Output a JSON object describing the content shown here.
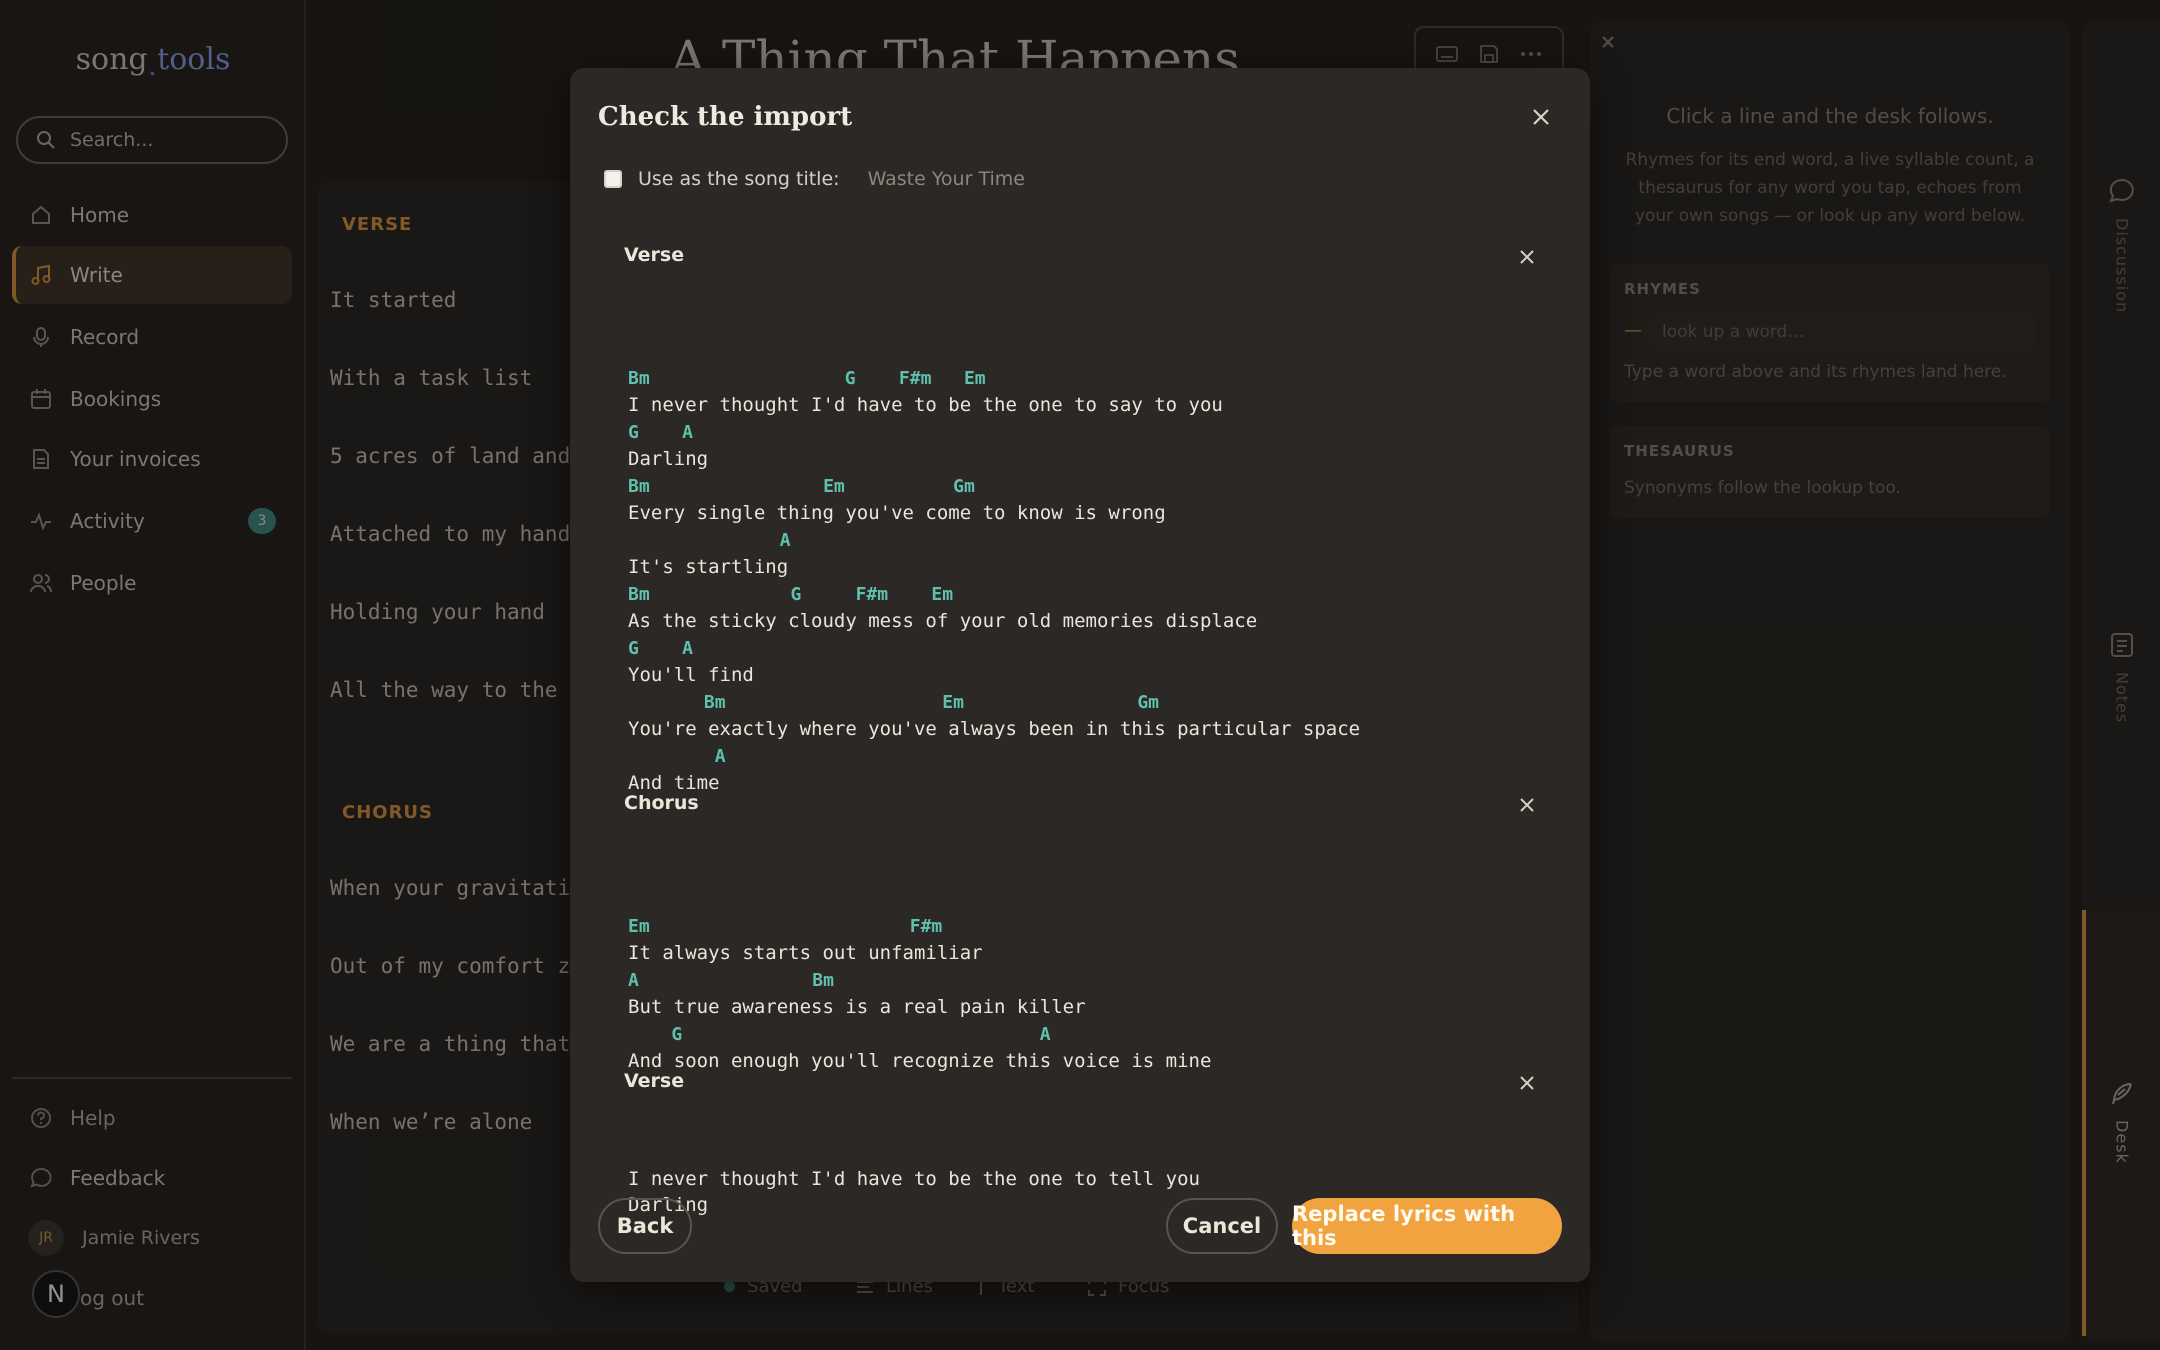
{
  "app": {
    "logo_song": "song",
    "logo_tools": "tools",
    "search_placeholder": "Search..."
  },
  "nav": [
    {
      "label": "Home",
      "icon": "home-icon"
    },
    {
      "label": "Write",
      "icon": "music-note-icon",
      "active": true
    },
    {
      "label": "Record",
      "icon": "microphone-icon"
    },
    {
      "label": "Bookings",
      "icon": "calendar-icon"
    },
    {
      "label": "Your invoices",
      "icon": "document-icon"
    },
    {
      "label": "Activity",
      "icon": "activity-icon",
      "badge": "3"
    },
    {
      "label": "People",
      "icon": "people-icon"
    }
  ],
  "footer": {
    "help": "Help",
    "feedback": "Feedback",
    "user_initials": "JR",
    "user_name": "Jamie Rivers",
    "logout": "og out",
    "n_badge": "N"
  },
  "editor": {
    "title": "A Thing That Happens",
    "verse_label": "VERSE",
    "verse_lines": [
      "It started",
      "With a task list",
      "5 acres of land and",
      "Attached to my hand",
      "Holding your hand",
      "All the way to the"
    ],
    "chorus_label": "CHORUS",
    "chorus_lines": [
      "When your gravitati",
      "Out of my comfort z",
      "We are a thing that",
      "When we’re alone"
    ],
    "status": {
      "saved": "Saved",
      "lines": "Lines",
      "text": "Text",
      "focus": "Focus"
    }
  },
  "desk": {
    "lead": "Click a line and the desk follows.",
    "sub": "Rhymes for its end word, a live syllable count, a thesaurus for any word you tap, echoes from your own songs — or look up any word below.",
    "rhymes_title": "RHYMES",
    "rhymes_placeholder": "look up a word…",
    "rhymes_hint": "Type a word above and its rhymes land here.",
    "thesaurus_title": "THESAURUS",
    "thesaurus_hint": "Synonyms follow the lookup too.",
    "rail": {
      "discussion": "Discussion",
      "notes": "Notes",
      "desk": "Desk"
    }
  },
  "modal": {
    "title": "Check the import",
    "use_title_label": "Use as the song title:",
    "song_title_value": "Waste Your Time",
    "sections": [
      {
        "name": "Verse",
        "lines": [
          {
            "chords": "Bm                  G    F#m   Em",
            "lyric": "I never thought I'd have to be the one to say to you"
          },
          {
            "chords": "G    A",
            "lyric": "Darling"
          },
          {
            "chords": "Bm                Em          Gm",
            "lyric": "Every single thing you've come to know is wrong"
          },
          {
            "chords": "              A",
            "lyric": "It's startling"
          },
          {
            "chords": "Bm             G     F#m    Em",
            "lyric": "As the sticky cloudy mess of your old memories displace"
          },
          {
            "chords": "G    A",
            "lyric": "You'll find"
          },
          {
            "chords": "       Bm                    Em                Gm",
            "lyric": "You're exactly where you've always been in this particular space"
          },
          {
            "chords": "        A",
            "lyric": "And time"
          }
        ]
      },
      {
        "name": "Chorus",
        "lines": [
          {
            "chords": "Em                        F#m",
            "lyric": "It always starts out unfamiliar"
          },
          {
            "chords": "A                Bm",
            "lyric": "But true awareness is a real pain killer"
          },
          {
            "chords": "    G                                 A",
            "lyric": "And soon enough you'll recognize this voice is mine"
          }
        ]
      },
      {
        "name": "Verse",
        "lines": [
          {
            "chords": "",
            "lyric": "I never thought I'd have to be the one to tell you"
          },
          {
            "chords": "",
            "lyric": "Darling"
          }
        ]
      }
    ],
    "buttons": {
      "back": "Back",
      "cancel": "Cancel",
      "replace": "Replace lyrics with this"
    }
  },
  "colors": {
    "accent": "#f0a33e",
    "chord": "#5fc0ae",
    "background": "#1f1c18",
    "modal": "#2b2825"
  }
}
